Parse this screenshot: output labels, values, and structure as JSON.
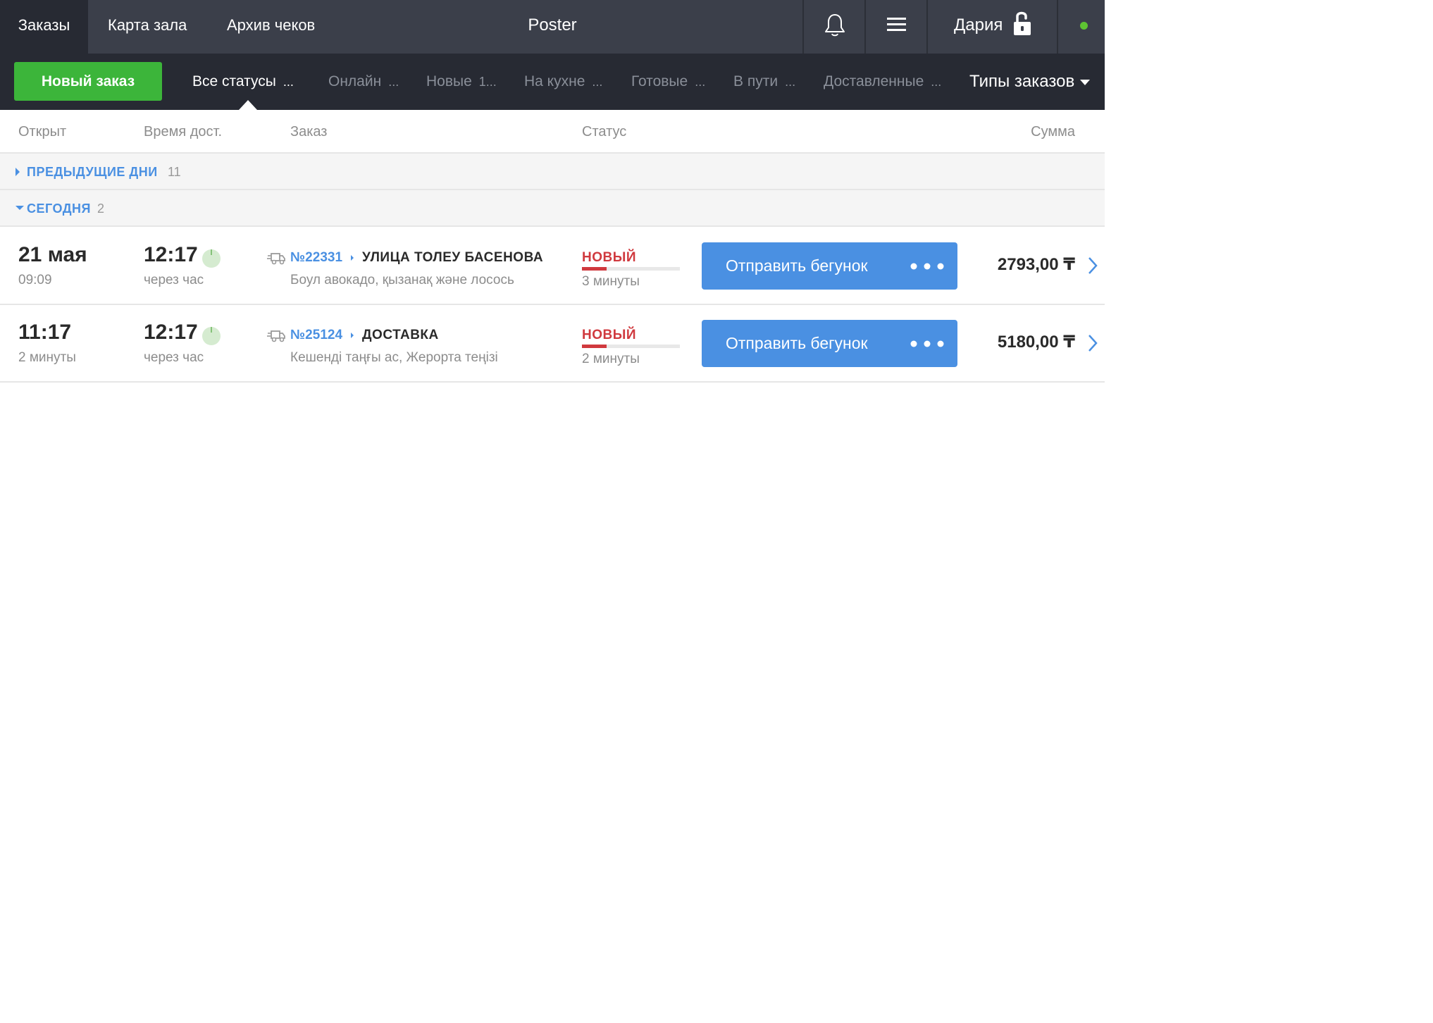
{
  "topbar": {
    "tabs": [
      {
        "label": "Заказы",
        "active": true
      },
      {
        "label": "Карта зала",
        "active": false
      },
      {
        "label": "Архив чеков",
        "active": false
      }
    ],
    "app_title": "Poster",
    "icons": {
      "notifications": "bell-icon",
      "menu": "hamburger-menu-icon",
      "lock": "unlocked-padlock-icon"
    },
    "user_name": "Дария",
    "online": true
  },
  "filterbar": {
    "new_order_label": "Новый заказ",
    "tabs": [
      {
        "label": "Все статусы",
        "count": "...",
        "active": true
      },
      {
        "label": "Онлайн",
        "count": "..."
      },
      {
        "label": "Новые",
        "count": "1..."
      },
      {
        "label": "На кухне",
        "count": "..."
      },
      {
        "label": "Готовые",
        "count": "..."
      },
      {
        "label": "В пути",
        "count": "..."
      },
      {
        "label": "Доставленные",
        "count": "..."
      }
    ],
    "types_label": "Типы заказов"
  },
  "columns": {
    "opened": "Открыт",
    "delivery_time": "Время дост.",
    "order": "Заказ",
    "status": "Статус",
    "sum": "Сумма"
  },
  "groups": {
    "previous": {
      "label": "ПРЕДЫДУЩИЕ ДНИ",
      "count": "11",
      "expanded": false
    },
    "today": {
      "label": "СЕГОДНЯ",
      "count": "2",
      "expanded": true
    }
  },
  "orders": [
    {
      "opened": "21 мая",
      "opened_sub": "09:09",
      "delivery_time": "12:17",
      "delivery_sub": "через час",
      "number": "№22331",
      "destination": "УЛИЦА ТОЛЕУ БАСЕНОВА",
      "items": "Боул авокадо, қызанақ және лосось",
      "status": "НОВЫЙ",
      "status_progress": 0.25,
      "status_sub": "3 минуты",
      "action_label": "Отправить бегунок",
      "amount": "2793,00 ₸"
    },
    {
      "opened": "11:17",
      "opened_sub": "2 минуты",
      "delivery_time": "12:17",
      "delivery_sub": "через час",
      "number": "№25124",
      "destination": "ДОСТАВКА",
      "items": "Кешенді таңғы ас, Жерорта теңізі",
      "status": "НОВЫЙ",
      "status_progress": 0.25,
      "status_sub": "2 минуты",
      "action_label": "Отправить бегунок",
      "amount": "5180,00 ₸"
    }
  ],
  "colors": {
    "topbar_bg": "#3b3f4a",
    "filterbar_bg": "#272a33",
    "new_order_green": "#3cb53a",
    "accent_blue": "#4a90e2",
    "status_red": "#d0393e",
    "online_green": "#5ec332"
  }
}
